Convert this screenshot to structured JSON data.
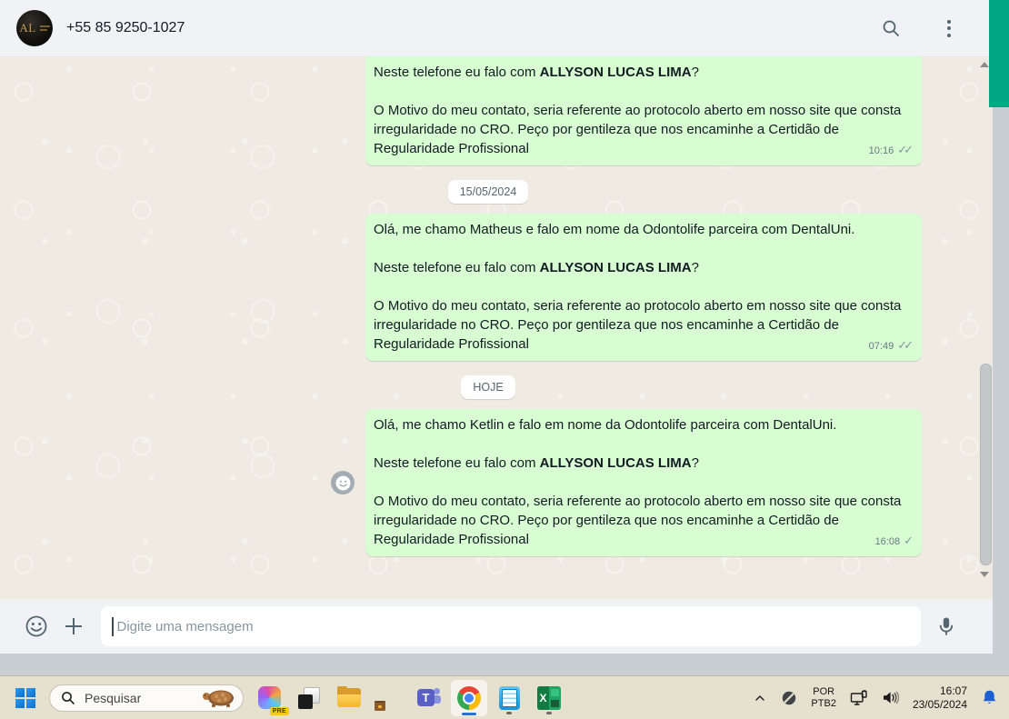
{
  "header": {
    "title": "+55 85 9250-1027",
    "avatar_text": "AL"
  },
  "chat": {
    "date_separators": [
      "15/05/2024",
      "HOJE"
    ],
    "messages": [
      {
        "ask_prefix": "Neste telefone eu falo com ",
        "ask_name": "ALLYSON LUCAS LIMA",
        "ask_suffix": "?",
        "body": "O Motivo do meu contato, seria referente ao protocolo aberto em nosso site que consta irregularidade no CRO. Peço por gentileza que nos encaminhe a Certidão de Regularidade Profissional",
        "time": "10:16",
        "status": "delivered"
      },
      {
        "intro": "Olá, me chamo Matheus e falo em nome da Odontolife parceira com DentalUni.",
        "ask_prefix": "Neste telefone eu falo com ",
        "ask_name": "ALLYSON LUCAS LIMA",
        "ask_suffix": "?",
        "body": "O Motivo do meu contato, seria referente ao protocolo aberto em nosso site que consta irregularidade no CRO. Peço por gentileza que nos encaminhe a Certidão de Regularidade Profissional",
        "time": "07:49",
        "status": "delivered"
      },
      {
        "intro": "Olá, me chamo Ketlin e falo em nome da Odontolife parceira com DentalUni.",
        "ask_prefix": "Neste telefone eu falo com ",
        "ask_name": "ALLYSON LUCAS LIMA",
        "ask_suffix": "?",
        "body": "O Motivo do meu contato, seria referente ao protocolo aberto em nosso site que consta irregularidade no CRO. Peço por gentileza que nos encaminhe a Certidão de Regularidade Profissional",
        "time": "16:08",
        "status": "sent"
      }
    ]
  },
  "composer": {
    "placeholder": "Digite uma mensagem",
    "value": ""
  },
  "icons": {
    "double_check": "✓✓",
    "single_check": "✓",
    "teams_letter": "T",
    "excel_letter": "X"
  },
  "taskbar": {
    "search_placeholder": "Pesquisar",
    "copilot_badge": "PRE",
    "language_line1": "POR",
    "language_line2": "PTB2",
    "clock_time": "16:07",
    "clock_date": "23/05/2024"
  },
  "colors": {
    "accent_green": "#00a884",
    "bubble_green": "#d9fdd3",
    "chat_background": "#efeae2",
    "header_background": "#f0f2f5",
    "taskbar_background": "#e6e1cf",
    "bell_blue": "#1d5fd2",
    "copilot_badge_yellow": "#f6c915"
  },
  "icon_names": [
    "search-icon",
    "menu-icon",
    "emoji-icon",
    "plus-icon",
    "mic-icon",
    "double-check-icon",
    "single-check-icon",
    "reaction-smiley-icon",
    "scroll-up-arrow",
    "scroll-down-arrow",
    "windows-start-icon",
    "taskbar-search-icon",
    "turtle-image",
    "copilot-icon",
    "task-view-icon",
    "file-explorer-icon",
    "edge-icon",
    "teams-icon",
    "chrome-icon",
    "notepad-icon",
    "excel-icon",
    "tray-chevron-up-icon",
    "tray-disabled-status-icon",
    "network-icon",
    "volume-icon",
    "notification-bell-icon"
  ]
}
